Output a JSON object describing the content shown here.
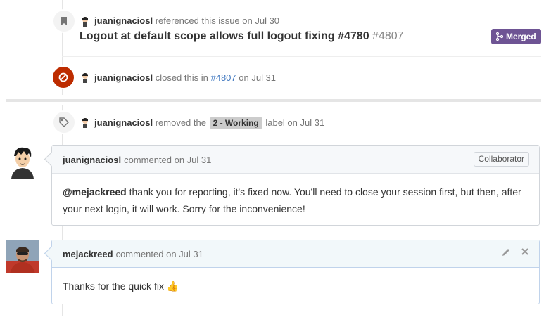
{
  "events": {
    "referenced": {
      "user": "juanignaciosl",
      "action": "referenced this issue on Jul 30",
      "pr_title": "Logout at default scope allows full logout fixing #4780",
      "pr_number": "#4807",
      "status": "Merged"
    },
    "closed": {
      "user": "juanignaciosl",
      "action_before": "closed this in",
      "ref": "#4807",
      "action_after": "on Jul 31"
    },
    "label_removed": {
      "user": "juanignaciosl",
      "action_before": "removed the",
      "label": "2 - Working",
      "action_after": "label on Jul 31"
    }
  },
  "comments": [
    {
      "author": "juanignaciosl",
      "meta": "commented on Jul 31",
      "role": "Collaborator",
      "mention": "@mejackreed",
      "body": " thank you for reporting, it's fixed now. You'll need to close your session first, but then, after your next login, it will work. Sorry for the inconvenience!"
    },
    {
      "author": "mejackreed",
      "meta": "commented on Jul 31",
      "body": "Thanks for the quick fix",
      "emoji": "👍"
    }
  ],
  "icons": {
    "bookmark": "bookmark-icon",
    "closed": "circle-slash-icon",
    "tag": "tag-icon",
    "merge": "git-merge-icon",
    "edit": "pencil-icon",
    "delete": "x-icon"
  },
  "colors": {
    "merged": "#6e5494",
    "closed": "#bd2c00",
    "link": "#4078c0",
    "label": "#cccccc"
  }
}
